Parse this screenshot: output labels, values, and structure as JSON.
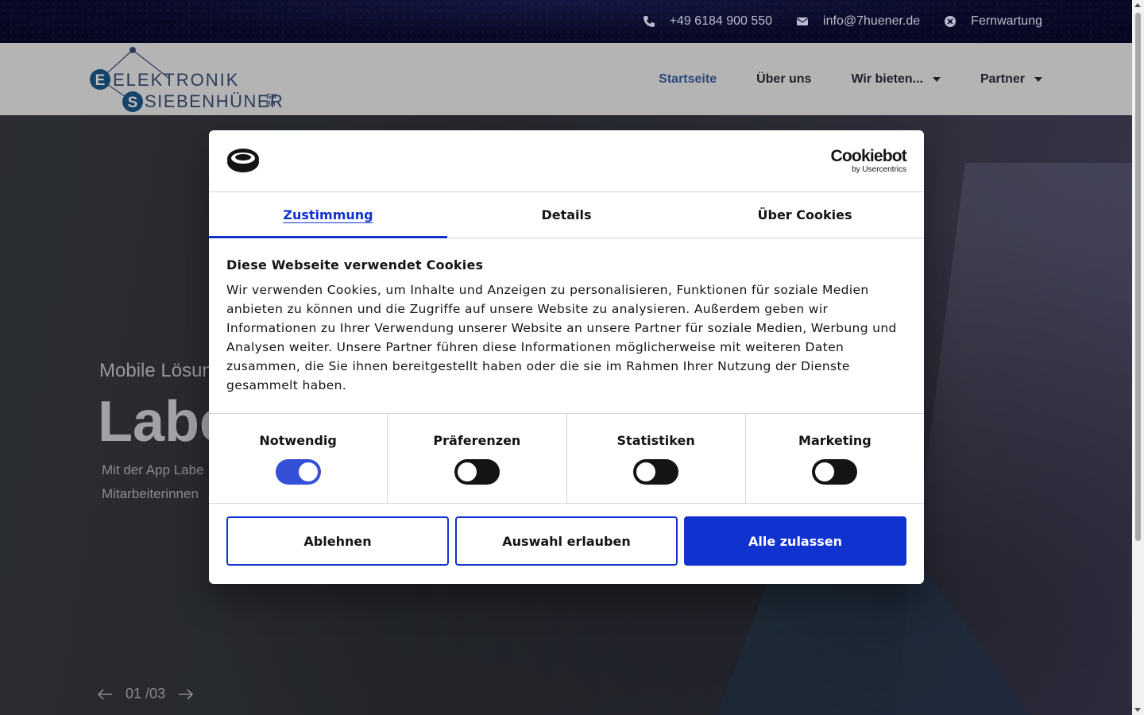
{
  "topbar": {
    "phone": "+49 6184 900 550",
    "email": "info@7huener.de",
    "remote": "Fernwartung"
  },
  "logo": {
    "line1": "ELEKTRONIK",
    "line2": "SIEBENHÜNER",
    "suffix_top": "GM",
    "suffix_bottom": "BH"
  },
  "nav": {
    "items": [
      {
        "label": "Startseite"
      },
      {
        "label": "Über uns"
      },
      {
        "label": "Wir bieten..."
      },
      {
        "label": "Partner"
      }
    ]
  },
  "hero": {
    "subtitle": "Mobile Lösun",
    "title": "Labe",
    "text_line1": "Mit der App Labe",
    "text_line2": "Mitarbeiterinnen",
    "counter_current": "01",
    "counter_total": "/03"
  },
  "cookie": {
    "brand_name": "Cookiebot",
    "brand_sub": "by Usercentrics",
    "tabs": [
      "Zustimmung",
      "Details",
      "Über Cookies"
    ],
    "title": "Diese Webseite verwendet Cookies",
    "text": "Wir verwenden Cookies, um Inhalte und Anzeigen zu personalisieren, Funktionen für soziale Medien anbieten zu können und die Zugriffe auf unsere Website zu analysieren. Außerdem geben wir Informationen zu Ihrer Verwendung unserer Website an unsere Partner für soziale Medien, Werbung und Analysen weiter. Unsere Partner führen diese Informationen möglicherweise mit weiteren Daten zusammen, die Sie ihnen bereitgestellt haben oder die sie im Rahmen Ihrer Nutzung der Dienste gesammelt haben.",
    "categories": [
      {
        "label": "Notwendig",
        "checked": true
      },
      {
        "label": "Präferenzen",
        "checked": false
      },
      {
        "label": "Statistiken",
        "checked": false
      },
      {
        "label": "Marketing",
        "checked": false
      }
    ],
    "buttons": {
      "decline": "Ablehnen",
      "allow_selection": "Auswahl erlauben",
      "allow_all": "Alle zulassen"
    },
    "accent_color": "#1032cf"
  }
}
